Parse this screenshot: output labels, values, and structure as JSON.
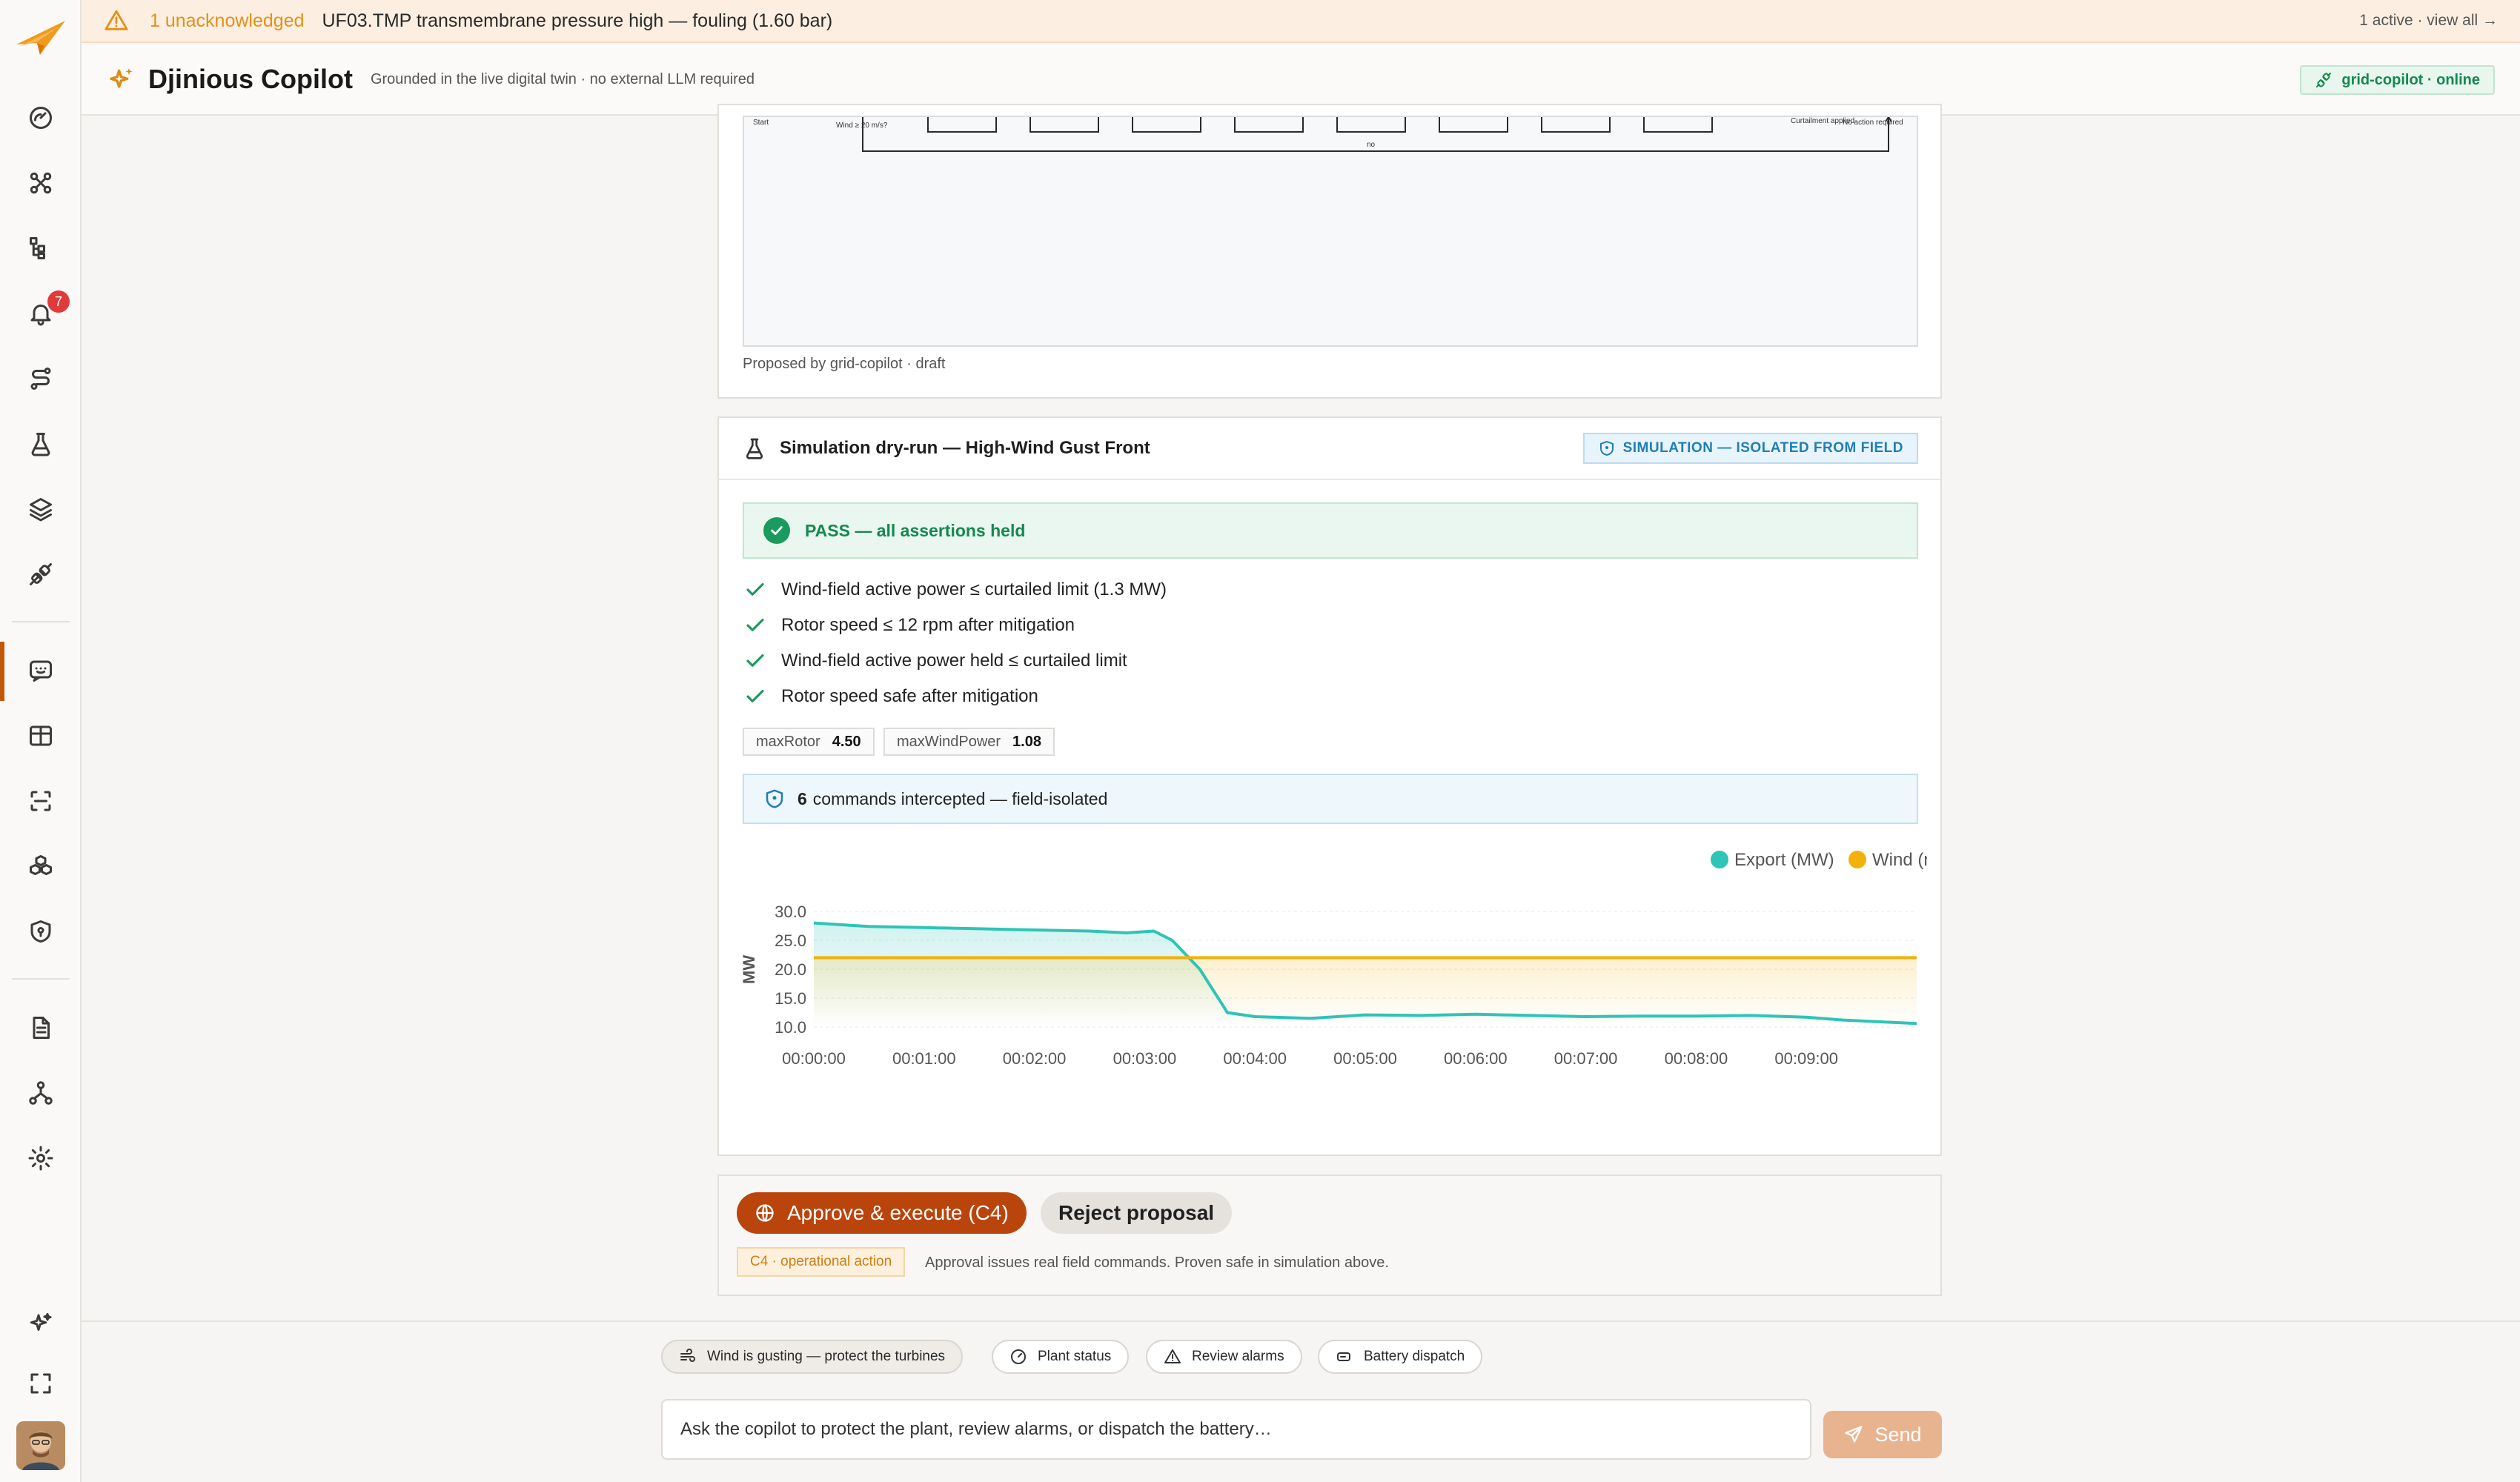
{
  "banner": {
    "unack": "1 unacknowledged",
    "message": "UF03.TMP transmembrane pressure high — fouling (1.60 bar)",
    "right": "1 active · view all →"
  },
  "header": {
    "title": "Djinious Copilot",
    "subtitle": "Grounded in the live digital twin · no external LLM required",
    "status": "grid-copilot · online"
  },
  "sidebar": {
    "alarm_count": "7",
    "items": [
      "dashboard-icon",
      "topology-icon",
      "hierarchy-icon",
      "bell-icon",
      "flow-icon",
      "flask-icon",
      "layers-icon",
      "plug-icon",
      "copilot-chat-icon",
      "table-icon",
      "scan-icon",
      "boxes-icon",
      "shield-icon",
      "document-icon",
      "network-icon",
      "settings-icon",
      "sparkle-icon",
      "fullscreen-icon"
    ]
  },
  "proposal": {
    "diagram_labels": {
      "start": "Start",
      "decision": "Wind ≥ 20 m/s?",
      "no": "no",
      "applied": "Curtailment applied",
      "noaction": "No action required"
    },
    "note": "Proposed by grid-copilot · draft"
  },
  "simulation": {
    "title": "Simulation dry-run — High-Wind Gust Front",
    "isolated": "SIMULATION — ISOLATED FROM FIELD",
    "pass": "PASS — all assertions held",
    "assertions": [
      "Wind-field active power ≤ curtailed limit (1.3 MW)",
      "Rotor speed ≤ 12 rpm after mitigation",
      "Wind-field active power held ≤ curtailed limit",
      "Rotor speed safe after mitigation"
    ],
    "metrics": [
      {
        "name": "maxRotor",
        "value": "4.50"
      },
      {
        "name": "maxWindPower",
        "value": "1.08"
      }
    ],
    "intercept_count": "6",
    "intercept_text": "commands intercepted — field-isolated"
  },
  "chart_data": {
    "type": "line",
    "ylabel": "MW",
    "ylim": [
      10,
      30
    ],
    "yticks": [
      "10.0",
      "15.0",
      "20.0",
      "25.0",
      "30.0"
    ],
    "categories": [
      "00:00:00",
      "00:01:00",
      "00:02:00",
      "00:03:00",
      "00:04:00",
      "00:05:00",
      "00:06:00",
      "00:07:00",
      "00:08:00",
      "00:09:00"
    ],
    "x_seconds": [
      0,
      30,
      60,
      90,
      120,
      150,
      170,
      185,
      195,
      210,
      225,
      240,
      270,
      300,
      330,
      360,
      390,
      420,
      450,
      480,
      510,
      540,
      560,
      600
    ],
    "series": [
      {
        "name": "Export (MW)",
        "color": "#2ec4b6",
        "values": [
          28.0,
          27.4,
          27.2,
          27.0,
          26.8,
          26.6,
          26.3,
          26.6,
          25.0,
          20.0,
          12.5,
          11.8,
          11.5,
          12.1,
          12.0,
          12.2,
          12.0,
          11.8,
          11.9,
          11.9,
          12.0,
          11.7,
          11.2,
          10.6
        ]
      },
      {
        "name": "Wind (m/s)",
        "color": "#f2b20c",
        "values": [
          22.0,
          22.0,
          22.0,
          22.0,
          22.0,
          22.0,
          22.0,
          22.0,
          22.0,
          22.0,
          22.0,
          22.0,
          22.0,
          22.0,
          22.0,
          22.0,
          22.0,
          22.0,
          22.0,
          22.0,
          22.0,
          22.0,
          22.0,
          22.0
        ]
      }
    ],
    "legend": "top-right",
    "grid": true
  },
  "approval": {
    "approve": "Approve & execute (C4)",
    "reject": "Reject proposal",
    "badge": "C4 · operational action",
    "note": "Approval issues real field commands. Proven safe in simulation above."
  },
  "composer": {
    "chips": [
      "Wind is gusting — protect the turbines",
      "Plant status",
      "Review alarms",
      "Battery dispatch"
    ],
    "placeholder": "Ask the copilot to protect the plant, review alarms, or dispatch the battery…",
    "send": "Send"
  }
}
